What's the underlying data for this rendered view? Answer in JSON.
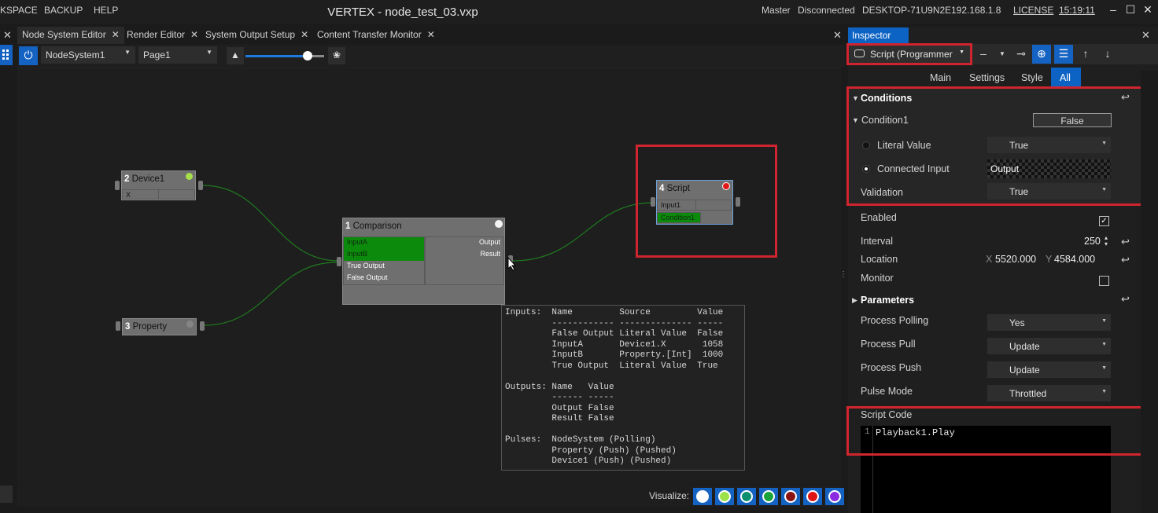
{
  "titlebar": {
    "menus": [
      "KSPACE",
      "BACKUP",
      "HELP"
    ],
    "title": "VERTEX - node_test_03.vxp",
    "master": "Master",
    "status": "Disconnected",
    "host": "DESKTOP-71U9N2E",
    "ip": "192.168.1.8",
    "license": "LICENSE",
    "time": "15:19:11"
  },
  "tabs": [
    {
      "label": "Node System Editor",
      "active": true
    },
    {
      "label": "Render Editor"
    },
    {
      "label": "System Output Setup"
    },
    {
      "label": "Content Transfer Monitor"
    }
  ],
  "toolbar": {
    "system": "NodeSystem1",
    "page": "Page1",
    "zoom_level": 0.79
  },
  "nodes": {
    "device": {
      "num": "2",
      "title": "Device1",
      "row": "X"
    },
    "property": {
      "num": "3",
      "title": "Property"
    },
    "comparison": {
      "num": "1",
      "title": "Comparison",
      "inputs": [
        "InputA",
        "InputB",
        "True Output",
        "False Output"
      ],
      "outputs": [
        "Output",
        "Result"
      ]
    },
    "script": {
      "num": "4",
      "title": "Script",
      "rows": [
        "Input1",
        "Condition1"
      ]
    }
  },
  "tooltip": {
    "text": "Inputs:  Name         Source         Value\n         ------------ -------------- -----\n         False Output Literal Value  False\n         InputA       Device1.X       1058\n         InputB       Property.[Int]  1000\n         True Output  Literal Value  True\n\nOutputs: Name   Value\n         ------ -----\n         Output False\n         Result False\n\nPulses:  NodeSystem (Polling)\n         Property (Push) (Pushed)\n         Device1 (Push) (Pushed)"
  },
  "visualize": {
    "label": "Visualize:",
    "colors": [
      "#ffffff",
      "#9be24a",
      "#0b8f6e",
      "#1aa33a",
      "#8a1414",
      "#e01616",
      "#8a2be2"
    ]
  },
  "inspector": {
    "tab": "Inspector",
    "script_select": "Script (Programmer",
    "segments": [
      "Main",
      "Settings",
      "Style",
      "All"
    ],
    "active_segment": "All",
    "conditions_header": "Conditions",
    "condition1": {
      "label": "Condition1",
      "value": "False"
    },
    "literal": {
      "label": "Literal Value",
      "value": "True"
    },
    "connected": {
      "label": "Connected Input",
      "value": "Output"
    },
    "validation": {
      "label": "Validation",
      "value": "True"
    },
    "enabled": {
      "label": "Enabled",
      "checked": true
    },
    "interval": {
      "label": "Interval",
      "value": "250"
    },
    "location": {
      "label": "Location",
      "x_label": "X",
      "x": "5520.000",
      "y_label": "Y",
      "y": "4584.000"
    },
    "monitor": {
      "label": "Monitor",
      "checked": false
    },
    "parameters_header": "Parameters",
    "params": [
      {
        "label": "Process Polling",
        "value": "Yes"
      },
      {
        "label": "Process Pull",
        "value": "Update"
      },
      {
        "label": "Process Push",
        "value": "Update"
      },
      {
        "label": "Pulse Mode",
        "value": "Throttled"
      }
    ],
    "script_code": {
      "label": "Script Code",
      "line": "1",
      "code": "Playback1.Play"
    }
  },
  "colors": {
    "accent": "#0d63c4",
    "highlight": "#d0252e",
    "green": "#0b8a0b"
  }
}
